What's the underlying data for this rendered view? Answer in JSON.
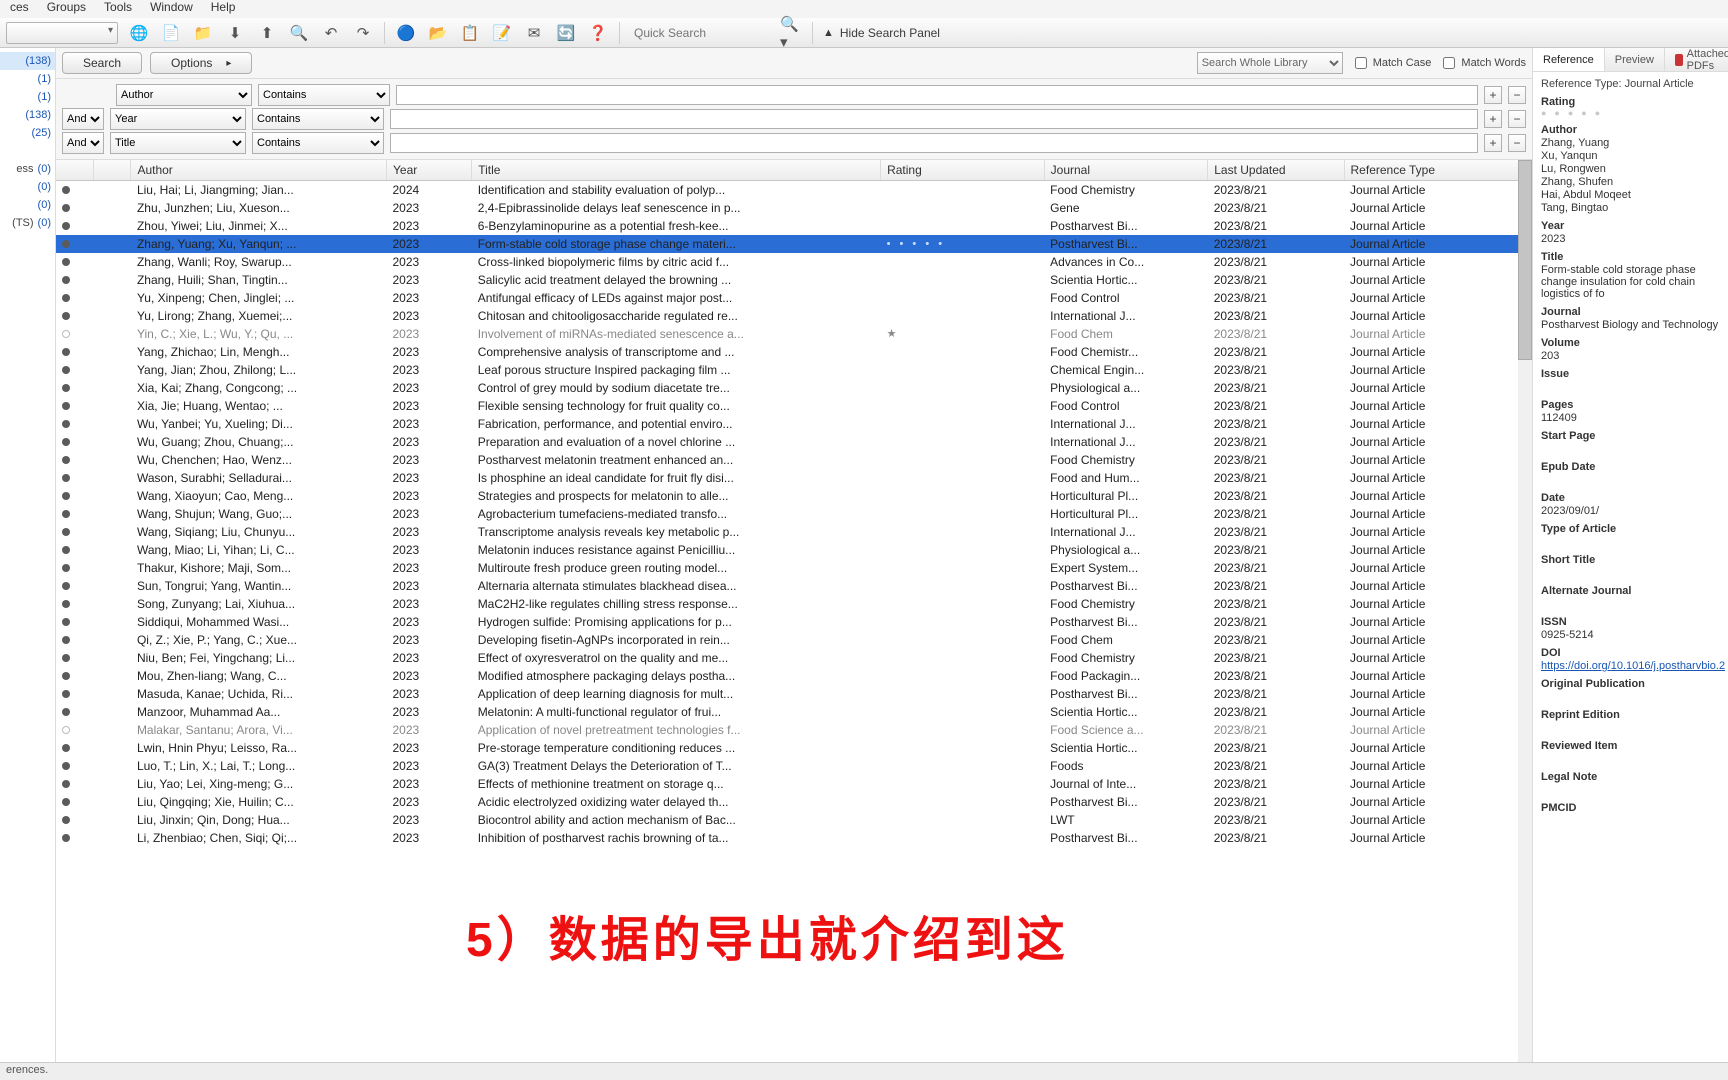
{
  "menus": [
    "ces",
    "Groups",
    "Tools",
    "Window",
    "Help"
  ],
  "toolbar": {
    "quick_search_placeholder": "Quick Search",
    "hide_search": "Hide Search Panel"
  },
  "sidebar_counts": [
    {
      "label": "",
      "count": "(138)",
      "sel": true
    },
    {
      "label": "",
      "count": "(1)"
    },
    {
      "label": "",
      "count": "(1)"
    },
    {
      "label": "",
      "count": "(138)"
    },
    {
      "label": "",
      "count": "(25)"
    },
    {
      "label": "",
      "count": ""
    },
    {
      "label": "ess",
      "count": "(0)"
    },
    {
      "label": "",
      "count": "(0)"
    },
    {
      "label": "",
      "count": "(0)"
    },
    {
      "label": "(TS)",
      "count": "(0)"
    }
  ],
  "search_panel": {
    "search_btn": "Search",
    "options_btn": "Options",
    "whole_lib": "Search Whole Library",
    "match_case": "Match Case",
    "match_words": "Match Words",
    "rows": [
      {
        "andor": "",
        "field": "Author",
        "op": "Contains",
        "term": ""
      },
      {
        "andor": "And",
        "field": "Year",
        "op": "Contains",
        "term": ""
      },
      {
        "andor": "And",
        "field": "Title",
        "op": "Contains",
        "term": ""
      }
    ]
  },
  "columns": [
    "",
    "",
    "Author",
    "Year",
    "Title",
    "Rating",
    "Journal",
    "Last Updated",
    "Reference Type"
  ],
  "rows": [
    {
      "d": "u",
      "a": "Liu, Hai; Li, Jiangming; Jian...",
      "y": "2024",
      "t": "Identification and stability evaluation of polyp...",
      "r": "",
      "j": "Food Chemistry",
      "u": "2023/8/21",
      "rt": "Journal Article"
    },
    {
      "d": "u",
      "a": "Zhu, Junzhen; Liu, Xueson...",
      "y": "2023",
      "t": "2,4-Epibrassinolide delays leaf senescence in p...",
      "r": "",
      "j": "Gene",
      "u": "2023/8/21",
      "rt": "Journal Article"
    },
    {
      "d": "u",
      "a": "Zhou, Yiwei; Liu, Jinmei; X...",
      "y": "2023",
      "t": "6-Benzylaminopurine as a potential fresh-kee...",
      "r": "",
      "j": "Postharvest Bi...",
      "u": "2023/8/21",
      "rt": "Journal Article"
    },
    {
      "d": "u",
      "sel": true,
      "a": "Zhang, Yuang; Xu, Yanqun; ...",
      "y": "2023",
      "t": "Form-stable cold storage phase change materi...",
      "r": "• • • • •",
      "j": "Postharvest Bi...",
      "u": "2023/8/21",
      "rt": "Journal Article"
    },
    {
      "d": "u",
      "a": "Zhang, Wanli; Roy, Swarup...",
      "y": "2023",
      "t": "Cross-linked biopolymeric films by citric acid f...",
      "r": "",
      "j": "Advances in Co...",
      "u": "2023/8/21",
      "rt": "Journal Article"
    },
    {
      "d": "u",
      "a": "Zhang, Huili; Shan, Tingtin...",
      "y": "2023",
      "t": "Salicylic acid treatment delayed the browning ...",
      "r": "",
      "j": "Scientia Hortic...",
      "u": "2023/8/21",
      "rt": "Journal Article"
    },
    {
      "d": "u",
      "a": "Yu, Xinpeng; Chen, Jinglei; ...",
      "y": "2023",
      "t": "Antifungal efficacy of LEDs against major post...",
      "r": "",
      "j": "Food Control",
      "u": "2023/8/21",
      "rt": "Journal Article"
    },
    {
      "d": "u",
      "a": "Yu, Lirong; Zhang, Xuemei;...",
      "y": "2023",
      "t": "Chitosan and chitooligosaccharide regulated re...",
      "r": "",
      "j": "International J...",
      "u": "2023/8/21",
      "rt": "Journal Article"
    },
    {
      "d": "r",
      "dim": true,
      "a": "Yin, C.; Xie, L.; Wu, Y.; Qu, ...",
      "y": "2023",
      "t": "Involvement of miRNAs-mediated senescence a...",
      "r": "★",
      "j": "Food Chem",
      "u": "2023/8/21",
      "rt": "Journal Article"
    },
    {
      "d": "u",
      "a": "Yang, Zhichao; Lin, Mengh...",
      "y": "2023",
      "t": "Comprehensive analysis of transcriptome and ...",
      "r": "",
      "j": "Food Chemistr...",
      "u": "2023/8/21",
      "rt": "Journal Article"
    },
    {
      "d": "u",
      "a": "Yang, Jian; Zhou, Zhilong; L...",
      "y": "2023",
      "t": "Leaf porous structure Inspired packaging film ...",
      "r": "",
      "j": "Chemical Engin...",
      "u": "2023/8/21",
      "rt": "Journal Article"
    },
    {
      "d": "u",
      "a": "Xia, Kai; Zhang, Congcong; ...",
      "y": "2023",
      "t": "Control of grey mould by sodium diacetate tre...",
      "r": "",
      "j": "Physiological a...",
      "u": "2023/8/21",
      "rt": "Journal Article"
    },
    {
      "d": "u",
      "a": "Xia, Jie; Huang, Wentao; ...",
      "y": "2023",
      "t": "Flexible sensing technology for fruit quality co...",
      "r": "",
      "j": "Food Control",
      "u": "2023/8/21",
      "rt": "Journal Article"
    },
    {
      "d": "u",
      "a": "Wu, Yanbei; Yu, Xueling; Di...",
      "y": "2023",
      "t": "Fabrication, performance, and potential enviro...",
      "r": "",
      "j": "International J...",
      "u": "2023/8/21",
      "rt": "Journal Article"
    },
    {
      "d": "u",
      "a": "Wu, Guang; Zhou, Chuang;...",
      "y": "2023",
      "t": "Preparation and evaluation of a novel chlorine ...",
      "r": "",
      "j": "International J...",
      "u": "2023/8/21",
      "rt": "Journal Article"
    },
    {
      "d": "u",
      "a": "Wu, Chenchen; Hao, Wenz...",
      "y": "2023",
      "t": "Postharvest melatonin treatment enhanced an...",
      "r": "",
      "j": "Food Chemistry",
      "u": "2023/8/21",
      "rt": "Journal Article"
    },
    {
      "d": "u",
      "a": "Wason, Surabhi; Selladurai...",
      "y": "2023",
      "t": "Is phosphine an ideal candidate for fruit fly disi...",
      "r": "",
      "j": "Food and Hum...",
      "u": "2023/8/21",
      "rt": "Journal Article"
    },
    {
      "d": "u",
      "a": "Wang, Xiaoyun; Cao, Meng...",
      "y": "2023",
      "t": "Strategies and prospects for melatonin to alle...",
      "r": "",
      "j": "Horticultural Pl...",
      "u": "2023/8/21",
      "rt": "Journal Article"
    },
    {
      "d": "u",
      "a": "Wang, Shujun; Wang, Guo;...",
      "y": "2023",
      "t": "Agrobacterium tumefaciens-mediated transfo...",
      "r": "",
      "j": "Horticultural Pl...",
      "u": "2023/8/21",
      "rt": "Journal Article"
    },
    {
      "d": "u",
      "a": "Wang, Siqiang; Liu, Chunyu...",
      "y": "2023",
      "t": "Transcriptome analysis reveals key metabolic p...",
      "r": "",
      "j": "International J...",
      "u": "2023/8/21",
      "rt": "Journal Article"
    },
    {
      "d": "u",
      "a": "Wang, Miao; Li, Yihan; Li, C...",
      "y": "2023",
      "t": "Melatonin induces resistance against Penicilliu...",
      "r": "",
      "j": "Physiological a...",
      "u": "2023/8/21",
      "rt": "Journal Article"
    },
    {
      "d": "u",
      "a": "Thakur, Kishore; Maji, Som...",
      "y": "2023",
      "t": "Multiroute fresh produce green routing model...",
      "r": "",
      "j": "Expert System...",
      "u": "2023/8/21",
      "rt": "Journal Article"
    },
    {
      "d": "u",
      "a": "Sun, Tongrui; Yang, Wantin...",
      "y": "2023",
      "t": "Alternaria alternata stimulates blackhead disea...",
      "r": "",
      "j": "Postharvest Bi...",
      "u": "2023/8/21",
      "rt": "Journal Article"
    },
    {
      "d": "u",
      "a": "Song, Zunyang; Lai, Xiuhua...",
      "y": "2023",
      "t": "MaC2H2-like regulates chilling stress response...",
      "r": "",
      "j": "Food Chemistry",
      "u": "2023/8/21",
      "rt": "Journal Article"
    },
    {
      "d": "u",
      "a": "Siddiqui, Mohammed Wasi...",
      "y": "2023",
      "t": "Hydrogen sulfide: Promising applications for p...",
      "r": "",
      "j": "Postharvest Bi...",
      "u": "2023/8/21",
      "rt": "Journal Article"
    },
    {
      "d": "u",
      "a": "Qi, Z.; Xie, P.; Yang, C.; Xue...",
      "y": "2023",
      "t": "Developing fisetin-AgNPs incorporated in rein...",
      "r": "",
      "j": "Food Chem",
      "u": "2023/8/21",
      "rt": "Journal Article"
    },
    {
      "d": "u",
      "a": "Niu, Ben; Fei, Yingchang; Li...",
      "y": "2023",
      "t": "Effect of oxyresveratrol on the quality and me...",
      "r": "",
      "j": "Food Chemistry",
      "u": "2023/8/21",
      "rt": "Journal Article"
    },
    {
      "d": "u",
      "a": "Mou, Zhen-liang; Wang, C...",
      "y": "2023",
      "t": "Modified atmosphere packaging delays postha...",
      "r": "",
      "j": "Food Packagin...",
      "u": "2023/8/21",
      "rt": "Journal Article"
    },
    {
      "d": "u",
      "a": "Masuda, Kanae; Uchida, Ri...",
      "y": "2023",
      "t": "Application of deep learning diagnosis for mult...",
      "r": "",
      "j": "Postharvest Bi...",
      "u": "2023/8/21",
      "rt": "Journal Article"
    },
    {
      "d": "u",
      "a": "Manzoor, Muhammad Aa...",
      "y": "2023",
      "t": "Melatonin: A multi-functional regulator of frui...",
      "r": "",
      "j": "Scientia Hortic...",
      "u": "2023/8/21",
      "rt": "Journal Article"
    },
    {
      "d": "r",
      "dim": true,
      "a": "Malakar, Santanu; Arora, Vi...",
      "y": "2023",
      "t": "Application of novel pretreatment technologies f...",
      "r": "",
      "j": "Food Science a...",
      "u": "2023/8/21",
      "rt": "Journal Article"
    },
    {
      "d": "u",
      "a": "Lwin, Hnin Phyu; Leisso, Ra...",
      "y": "2023",
      "t": "Pre-storage temperature conditioning reduces ...",
      "r": "",
      "j": "Scientia Hortic...",
      "u": "2023/8/21",
      "rt": "Journal Article"
    },
    {
      "d": "u",
      "a": "Luo, T.; Lin, X.; Lai, T.; Long...",
      "y": "2023",
      "t": "GA(3) Treatment Delays the Deterioration of T...",
      "r": "",
      "j": "Foods",
      "u": "2023/8/21",
      "rt": "Journal Article"
    },
    {
      "d": "u",
      "a": "Liu, Yao; Lei, Xing-meng; G...",
      "y": "2023",
      "t": "Effects of methionine treatment on storage q...",
      "r": "",
      "j": "Journal of Inte...",
      "u": "2023/8/21",
      "rt": "Journal Article"
    },
    {
      "d": "u",
      "a": "Liu, Qingqing; Xie, Huilin; C...",
      "y": "2023",
      "t": "Acidic electrolyzed oxidizing water delayed th...",
      "r": "",
      "j": "Postharvest Bi...",
      "u": "2023/8/21",
      "rt": "Journal Article"
    },
    {
      "d": "u",
      "a": "Liu, Jinxin; Qin, Dong; Hua...",
      "y": "2023",
      "t": "Biocontrol ability and action mechanism of Bac...",
      "r": "",
      "j": "LWT",
      "u": "2023/8/21",
      "rt": "Journal Article"
    },
    {
      "d": "u",
      "a": "Li, Zhenbiao; Chen, Siqi; Qi;...",
      "y": "2023",
      "t": "Inhibition of postharvest rachis browning of ta...",
      "r": "",
      "j": "Postharvest Bi...",
      "u": "2023/8/21",
      "rt": "Journal Article"
    }
  ],
  "right_tabs": {
    "ref": "Reference",
    "prev": "Preview",
    "pdf": "Attached PDFs"
  },
  "details": {
    "ref_type_label": "Reference Type:",
    "ref_type": "Journal Article",
    "rating_label": "Rating",
    "author_label": "Author",
    "authors": [
      "Zhang, Yuang",
      "Xu, Yanqun",
      "Lu, Rongwen",
      "Zhang, Shufen",
      "Hai, Abdul Moqeet",
      "Tang, Bingtao"
    ],
    "year_label": "Year",
    "year": "2023",
    "title_label": "Title",
    "title": "Form-stable cold storage phase change insulation for cold chain logistics of fo",
    "journal_label": "Journal",
    "journal": "Postharvest Biology and Technology",
    "volume_label": "Volume",
    "volume": "203",
    "issue_label": "Issue",
    "pages_label": "Pages",
    "pages": "112409",
    "startpage_label": "Start Page",
    "epub_label": "Epub Date",
    "date_label": "Date",
    "date": "2023/09/01/",
    "toa_label": "Type of Article",
    "short_label": "Short Title",
    "alt_label": "Alternate Journal",
    "issn_label": "ISSN",
    "issn": "0925-5214",
    "doi_label": "DOI",
    "doi": "https://doi.org/10.1016/j.postharvbio.2",
    "orig_label": "Original Publication",
    "reprint_label": "Reprint Edition",
    "review_label": "Reviewed Item",
    "legal_label": "Legal Note",
    "pmcid_label": "PMCID"
  },
  "status_text": "erences.",
  "overlay": "5）数据的导出就介绍到这"
}
